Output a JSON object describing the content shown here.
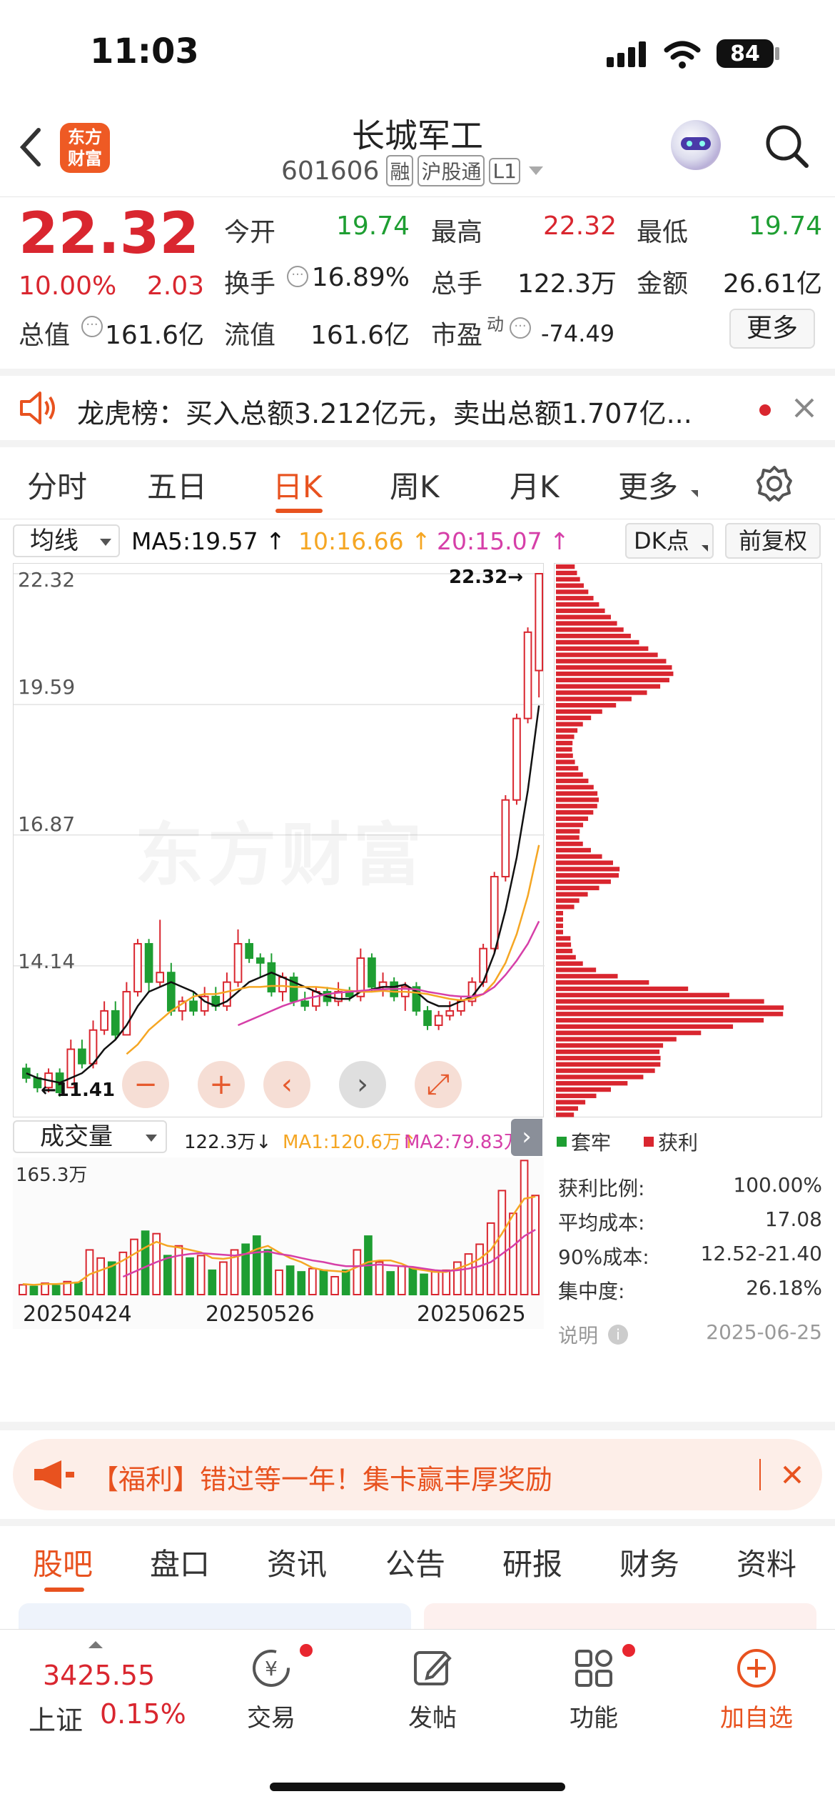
{
  "status_bar": {
    "time": "11:03",
    "battery": "84"
  },
  "header": {
    "logo_text": "东方财富",
    "title": "长城军工",
    "code": "601606",
    "badges": [
      "融",
      "沪股通",
      "L1"
    ]
  },
  "quote": {
    "price": "22.32",
    "change_pct": "10.00%",
    "change": "2.03",
    "labels": {
      "open": "今开",
      "high": "最高",
      "low": "最低",
      "turnover": "换手",
      "volume": "总手",
      "amount": "金额",
      "total_value": "总值",
      "float_value": "流值",
      "pe": "市盈",
      "pe_sup": "动"
    },
    "open": "19.74",
    "high": "22.32",
    "low": "19.74",
    "turnover": "16.89%",
    "volume": "122.3万",
    "amount": "26.61亿",
    "total_value": "161.6亿",
    "float_value": "161.6亿",
    "pe": "-74.49",
    "more": "更多"
  },
  "notice": {
    "text": "龙虎榜：买入总额3.212亿元，卖出总额1.707亿..."
  },
  "tabs": [
    "分时",
    "五日",
    "日K",
    "周K",
    "月K",
    "更多"
  ],
  "active_tab": "日K",
  "chart_toolbar": {
    "indicator": "均线",
    "ma5": "MA5:19.57",
    "ma10": "10:16.66",
    "ma20": "20:15.07",
    "dk": "DK点",
    "adjust": "前复权"
  },
  "colors": {
    "up": "#d9262f",
    "down": "#1e9e32",
    "ma5": "#111111",
    "ma10": "#f5a623",
    "ma20": "#d63fa8",
    "brand": "#e8521f"
  },
  "chart_data": [
    {
      "type": "candlestick",
      "y_ticks": [
        "22.32",
        "19.59",
        "16.87",
        "14.14"
      ],
      "ylim": [
        11.41,
        22.32
      ],
      "high_label": "22.32→",
      "low_label": "11.41",
      "watermark": "东方财富",
      "candles": [
        [
          12.0,
          11.8,
          12.1,
          11.7
        ],
        [
          11.8,
          11.6,
          11.9,
          11.5
        ],
        [
          11.6,
          11.9,
          12.0,
          11.5
        ],
        [
          11.9,
          11.5,
          12.0,
          11.41
        ],
        [
          11.6,
          12.4,
          12.6,
          11.6
        ],
        [
          12.4,
          12.1,
          12.6,
          12.0
        ],
        [
          12.1,
          12.8,
          13.0,
          12.0
        ],
        [
          12.8,
          13.2,
          13.4,
          12.7
        ],
        [
          13.2,
          12.7,
          13.4,
          12.6
        ],
        [
          12.7,
          13.6,
          13.8,
          12.7
        ],
        [
          13.6,
          14.6,
          14.7,
          13.5
        ],
        [
          14.6,
          13.8,
          14.7,
          13.6
        ],
        [
          13.8,
          14.0,
          15.1,
          13.7
        ],
        [
          14.0,
          13.2,
          14.2,
          13.1
        ],
        [
          13.2,
          13.4,
          13.5,
          13.0
        ],
        [
          13.4,
          13.2,
          13.6,
          13.1
        ],
        [
          13.2,
          13.5,
          13.7,
          13.1
        ],
        [
          13.5,
          13.3,
          13.7,
          13.2
        ],
        [
          13.3,
          13.8,
          14.0,
          13.2
        ],
        [
          13.8,
          14.6,
          14.9,
          13.7
        ],
        [
          14.6,
          14.3,
          14.7,
          14.2
        ],
        [
          14.3,
          14.2,
          14.4,
          13.9
        ],
        [
          14.2,
          13.6,
          14.4,
          13.5
        ],
        [
          13.6,
          13.9,
          14.0,
          13.4
        ],
        [
          13.9,
          13.4,
          14.0,
          13.3
        ],
        [
          13.4,
          13.3,
          13.6,
          13.2
        ],
        [
          13.3,
          13.6,
          13.7,
          13.2
        ],
        [
          13.6,
          13.4,
          13.7,
          13.3
        ],
        [
          13.4,
          13.6,
          13.8,
          13.3
        ],
        [
          13.6,
          13.5,
          13.7,
          13.4
        ],
        [
          13.5,
          14.3,
          14.5,
          13.4
        ],
        [
          14.3,
          13.7,
          14.4,
          13.6
        ],
        [
          13.7,
          13.8,
          14.0,
          13.5
        ],
        [
          13.8,
          13.5,
          13.9,
          13.4
        ],
        [
          13.5,
          13.7,
          13.8,
          13.2
        ],
        [
          13.7,
          13.2,
          13.8,
          13.1
        ],
        [
          13.2,
          12.9,
          13.3,
          12.8
        ],
        [
          12.9,
          13.1,
          13.2,
          12.8
        ],
        [
          13.1,
          13.2,
          13.4,
          13.0
        ],
        [
          13.2,
          13.4,
          13.5,
          13.1
        ],
        [
          13.4,
          13.8,
          13.9,
          13.3
        ],
        [
          13.8,
          14.5,
          14.6,
          13.7
        ],
        [
          14.5,
          16.0,
          16.1,
          14.4
        ],
        [
          16.0,
          17.6,
          17.7,
          15.9
        ],
        [
          17.6,
          19.3,
          19.4,
          17.5
        ],
        [
          19.3,
          21.1,
          21.2,
          19.2
        ],
        [
          20.3,
          22.32,
          22.32,
          19.74
        ]
      ],
      "ma5": [
        11.9,
        11.8,
        11.75,
        11.7,
        11.8,
        11.9,
        12.1,
        12.4,
        12.6,
        12.9,
        13.3,
        13.6,
        13.7,
        13.8,
        13.7,
        13.6,
        13.4,
        13.3,
        13.4,
        13.6,
        13.8,
        13.9,
        14.0,
        13.9,
        13.8,
        13.7,
        13.6,
        13.5,
        13.45,
        13.45,
        13.6,
        13.65,
        13.7,
        13.7,
        13.75,
        13.6,
        13.4,
        13.3,
        13.3,
        13.4,
        13.5,
        13.8,
        14.4,
        15.3,
        16.4,
        17.8,
        19.57
      ],
      "ma10": [
        null,
        null,
        null,
        null,
        null,
        null,
        null,
        null,
        null,
        12.3,
        12.5,
        12.8,
        13.0,
        13.2,
        13.35,
        13.5,
        13.55,
        13.55,
        13.6,
        13.65,
        13.7,
        13.7,
        13.72,
        13.72,
        13.7,
        13.7,
        13.7,
        13.68,
        13.65,
        13.62,
        13.6,
        13.6,
        13.62,
        13.6,
        13.6,
        13.58,
        13.55,
        13.5,
        13.45,
        13.42,
        13.45,
        13.55,
        13.8,
        14.2,
        14.8,
        15.6,
        16.66
      ],
      "ma20": [
        null,
        null,
        null,
        null,
        null,
        null,
        null,
        null,
        null,
        null,
        null,
        null,
        null,
        null,
        null,
        null,
        null,
        null,
        null,
        12.9,
        13.0,
        13.1,
        13.2,
        13.3,
        13.38,
        13.45,
        13.5,
        13.55,
        13.58,
        13.6,
        13.62,
        13.64,
        13.65,
        13.66,
        13.66,
        13.65,
        13.6,
        13.56,
        13.52,
        13.5,
        13.5,
        13.55,
        13.7,
        13.95,
        14.25,
        14.6,
        15.07
      ],
      "volume_profile": "chip distribution bars"
    },
    {
      "type": "bar",
      "label": "成交量",
      "volume": "122.3万",
      "ma1": [
        13,
        12,
        13,
        13,
        14,
        15,
        25,
        30,
        35,
        42,
        50,
        58,
        65,
        60,
        58,
        55,
        52,
        45,
        44,
        46,
        50,
        56,
        60,
        52,
        45,
        40,
        33,
        30,
        29,
        28,
        34,
        40,
        42,
        42,
        38,
        32,
        30,
        28,
        28,
        32,
        37,
        44,
        55,
        75,
        98,
        118,
        120.6
      ],
      "ma2": [
        null,
        null,
        null,
        null,
        null,
        null,
        null,
        null,
        null,
        22,
        28,
        34,
        40,
        45,
        48,
        50,
        51,
        50,
        49,
        48,
        50,
        52,
        53,
        50,
        48,
        45,
        42,
        40,
        37,
        35,
        35,
        36,
        37,
        36,
        35,
        34,
        32,
        30,
        29,
        30,
        32,
        35,
        40,
        50,
        60,
        72,
        79.83
      ],
      "max_label": "165.3万",
      "x_ticks": [
        "20250424",
        "20250526",
        "20250625"
      ],
      "values": [
        12,
        10,
        14,
        11,
        16,
        15,
        55,
        45,
        40,
        52,
        68,
        78,
        75,
        48,
        60,
        45,
        48,
        30,
        40,
        55,
        62,
        72,
        55,
        30,
        35,
        28,
        32,
        30,
        22,
        30,
        55,
        72,
        40,
        28,
        35,
        32,
        25,
        28,
        30,
        40,
        50,
        62,
        88,
        128,
        100,
        165,
        122
      ],
      "up": [
        1,
        0,
        1,
        0,
        1,
        0,
        1,
        1,
        0,
        1,
        1,
        0,
        1,
        0,
        1,
        0,
        1,
        0,
        1,
        1,
        0,
        0,
        0,
        1,
        0,
        0,
        1,
        0,
        1,
        0,
        1,
        0,
        1,
        0,
        1,
        0,
        0,
        1,
        1,
        1,
        1,
        1,
        1,
        1,
        1,
        1,
        1
      ]
    }
  ],
  "volume_toolbar": {
    "label": "成交量",
    "volume": "122.3万",
    "ma1": "MA1:120.6万",
    "ma2": "MA2:79.83万"
  },
  "chip_legend": {
    "trapped": "套牢",
    "profit": "获利"
  },
  "chip_stats": [
    {
      "label": "获利比例:",
      "value": "100.00%"
    },
    {
      "label": "平均成本:",
      "value": "17.08"
    },
    {
      "label": "90%成本:",
      "value": "12.52-21.40"
    },
    {
      "label": "集中度:",
      "value": "26.18%"
    }
  ],
  "chip_note": {
    "label": "说明",
    "date": "2025-06-25"
  },
  "promo": {
    "text": "【福利】错过等一年！集卡赢丰厚奖励"
  },
  "feature_tabs": [
    "股吧",
    "盘口",
    "资讯",
    "公告",
    "研报",
    "财务",
    "资料"
  ],
  "active_feature_tab": "股吧",
  "bottom_bar": {
    "index_value": "3425.55",
    "index_name": "上证",
    "index_change": "0.15%",
    "items": [
      "交易",
      "发帖",
      "功能",
      "加自选"
    ]
  }
}
